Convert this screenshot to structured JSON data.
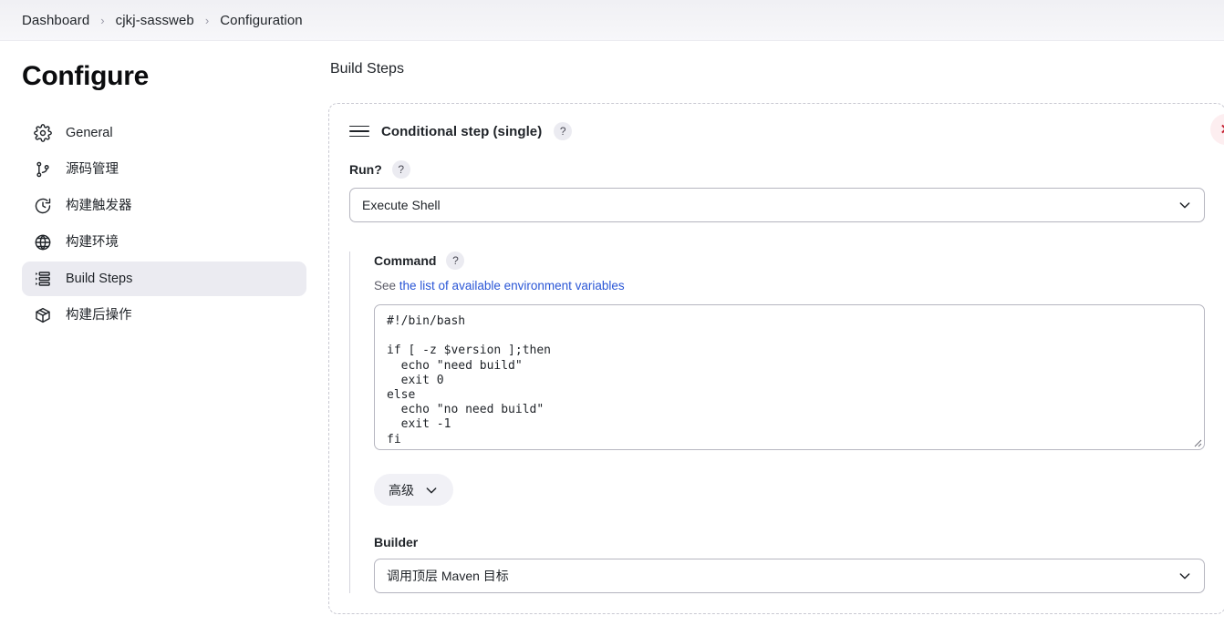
{
  "breadcrumb": {
    "items": [
      "Dashboard",
      "cjkj-sassweb",
      "Configuration"
    ],
    "separator": "›"
  },
  "sidebar": {
    "title": "Configure",
    "items": [
      {
        "label": "General",
        "icon": "gear-icon",
        "active": false
      },
      {
        "label": "源码管理",
        "icon": "git-branch-icon",
        "active": false
      },
      {
        "label": "构建触发器",
        "icon": "clock-icon",
        "active": false
      },
      {
        "label": "构建环境",
        "icon": "globe-icon",
        "active": false
      },
      {
        "label": "Build Steps",
        "icon": "list-icon",
        "active": true
      },
      {
        "label": "构建后操作",
        "icon": "package-icon",
        "active": false
      }
    ]
  },
  "main": {
    "section_title": "Build Steps",
    "step": {
      "title": "Conditional step (single)",
      "help_symbol": "?",
      "delete_symbol": "✕",
      "drag_handle_name": "drag-handle-icon",
      "run": {
        "label": "Run?",
        "help_symbol": "?",
        "selected": "Execute Shell"
      },
      "command": {
        "label": "Command",
        "help_symbol": "?",
        "hint_prefix": "See ",
        "hint_link": "the list of available environment variables",
        "script": "#!/bin/bash\n\nif [ -z $version ];then\n  echo \"need build\"\n  exit 0\nelse\n  echo \"no need build\"\n  exit -1\nfi"
      },
      "advanced": {
        "label": "高级",
        "chevron": "chevron-down-icon"
      },
      "builder": {
        "label": "Builder",
        "selected": "调用顶层 Maven 目标"
      }
    }
  },
  "colors": {
    "accent_link": "#2a56d6",
    "danger": "#c62334",
    "danger_bg": "#fdeef0",
    "active_nav_bg": "#ebebf1",
    "breadcrumb_bg": "#f2f2f6"
  }
}
